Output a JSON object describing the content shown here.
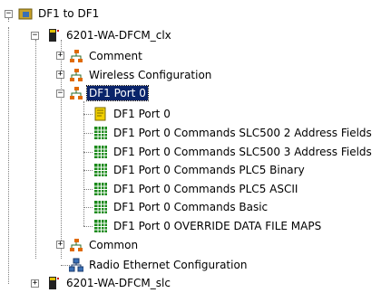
{
  "tree": {
    "root": {
      "label": "DF1 to DF1",
      "expander": "−"
    },
    "device1": {
      "label": "6201-WA-DFCM_clx",
      "expander": "−"
    },
    "comment": {
      "label": "Comment",
      "expander": "+"
    },
    "wireless": {
      "label": "Wireless Configuration",
      "expander": "+"
    },
    "port0": {
      "label": "DF1 Port 0",
      "expander": "−"
    },
    "port0_items": [
      {
        "label": "DF1 Port 0",
        "icon": "config-icon"
      },
      {
        "label": "DF1 Port 0 Commands SLC500 2 Address Fields",
        "icon": "grid-icon"
      },
      {
        "label": "DF1 Port 0 Commands SLC500 3 Address Fields",
        "icon": "grid-icon"
      },
      {
        "label": "DF1 Port 0 Commands PLC5 Binary",
        "icon": "grid-icon"
      },
      {
        "label": "DF1 Port 0 Commands PLC5 ASCII",
        "icon": "grid-icon"
      },
      {
        "label": "DF1 Port 0 Commands Basic",
        "icon": "grid-icon"
      },
      {
        "label": "DF1 Port 0 OVERRIDE DATA FILE MAPS",
        "icon": "grid-icon"
      }
    ],
    "common": {
      "label": "Common",
      "expander": "+"
    },
    "radio": {
      "label": "Radio Ethernet Configuration"
    },
    "device2": {
      "label": "6201-WA-DFCM_slc",
      "expander": "+"
    }
  },
  "colors": {
    "selection": "#0a246a",
    "grid_green": "#1a8a1a",
    "network_orange": "#e06a00"
  }
}
